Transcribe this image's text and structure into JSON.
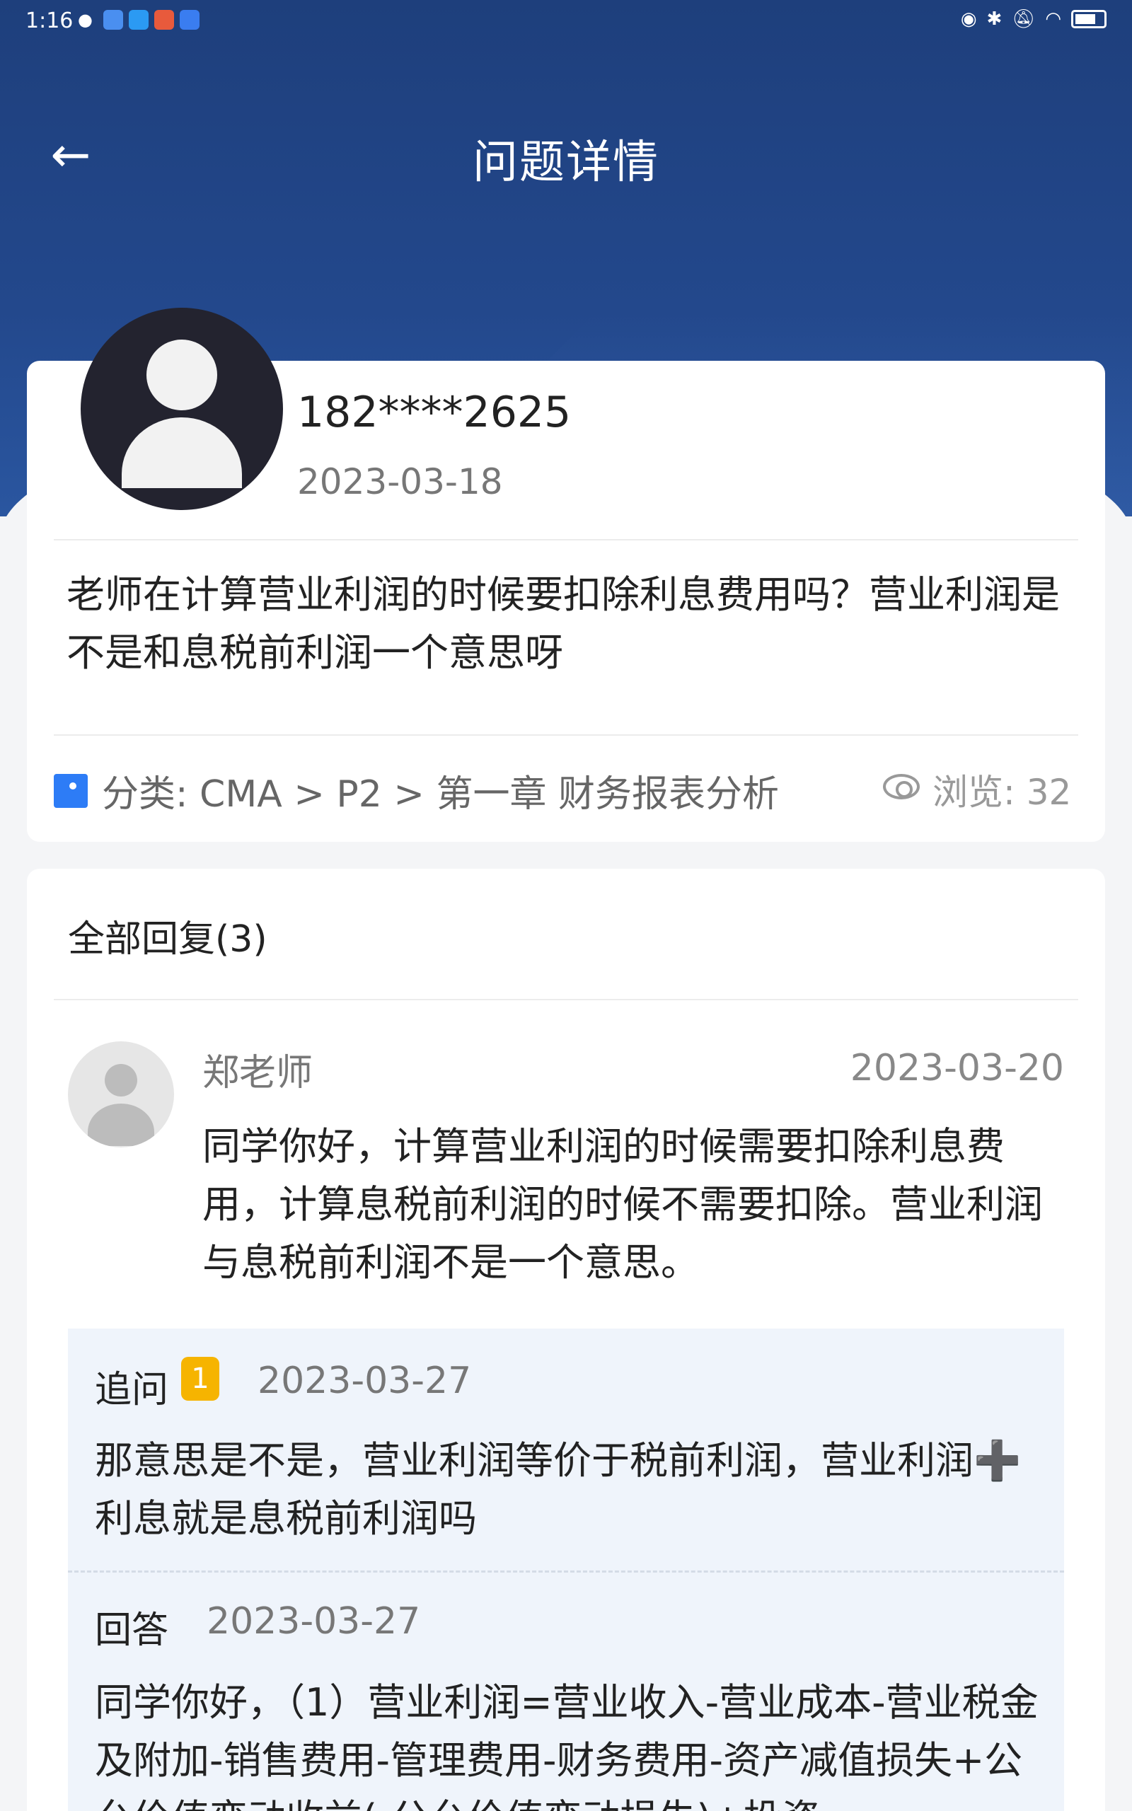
{
  "status_bar": {
    "time": "1:16"
  },
  "nav": {
    "title": "问题详情"
  },
  "question": {
    "user": "182****2625",
    "date": "2023-03-18",
    "text": "老师在计算营业利润的时候要扣除利息费用吗？营业利润是不是和息税前利润一个意思呀",
    "category": "分类: CMA > P2 > 第一章  财务报表分析",
    "views": "浏览: 32"
  },
  "replies": {
    "title": "全部回复(3)",
    "items": [
      {
        "name": "郑老师",
        "date": "2023-03-20",
        "text": "同学你好，计算营业利润的时候需要扣除利息费用，计算息税前利润的时候不需要扣除。营业利润与息税前利润不是一个意思。",
        "followup": {
          "label": "追问",
          "badge": "1",
          "date": "2023-03-27",
          "text": "那意思是不是，营业利润等价于税前利润，营业利润➕利息就是息税前利润吗"
        },
        "answer": {
          "label": "回答",
          "date": "2023-03-27",
          "text": "同学你好，（1）营业利润=营业收入-营业成本-营业税金及附加-销售费用-管理费用-财务费用-资产减值损失+公允价值变动收益(-公允价值变动损失)+投资"
        }
      }
    ]
  },
  "colors": {
    "header": "#1e3f7c",
    "accent": "#2d7cf6",
    "badge": "#f6b400",
    "followup_bg": "#eff4fb"
  }
}
